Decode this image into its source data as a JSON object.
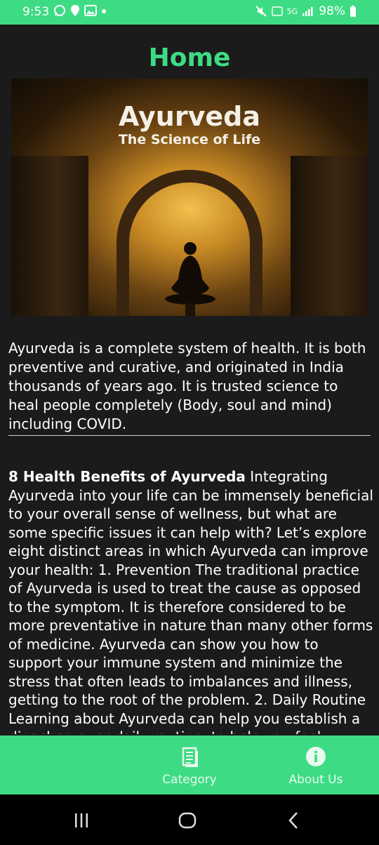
{
  "status_bar": {
    "time": "9:53",
    "battery": "98%",
    "network": "5G"
  },
  "page": {
    "title": "Home"
  },
  "banner": {
    "title": "Ayurveda",
    "subtitle": "The Science of Life"
  },
  "intro": {
    "text": " Ayurveda is a complete system of health. It is both preventive and curative, and originated in India thousands of years ago. It is trusted science to heal people completely (Body, soul and mind) including COVID."
  },
  "article": {
    "heading": "8 Health Benefits of Ayurveda",
    "body": " Integrating Ayurveda into your life can be immensely beneficial to your overall sense of wellness, but what are some specific issues it can help with? Let’s explore eight distinct areas in which Ayurveda can improve your health: 1. Prevention The traditional practice of Ayurveda is used to treat the cause as opposed to the symptom. It is therefore considered to be more preventative in nature than many other forms of medicine. Ayurveda can show you how to support your immune system and minimize the stress that often leads to imbalances and illness, getting to the root of the problem. 2. Daily Routine Learning about Ayurveda can help you establish a dinacharya, or daily routine, to help you feel"
  },
  "bottom_nav": {
    "category_label": "Category",
    "about_label": "About Us"
  },
  "colors": {
    "accent": "#3ddc84",
    "background": "#1b1b1b"
  },
  "icons": [
    "whatsapp-icon",
    "location-icon",
    "image-icon",
    "mute-icon",
    "signal-icon",
    "battery-icon",
    "document-icon",
    "info-icon",
    "recents-icon",
    "home-icon",
    "back-icon"
  ]
}
